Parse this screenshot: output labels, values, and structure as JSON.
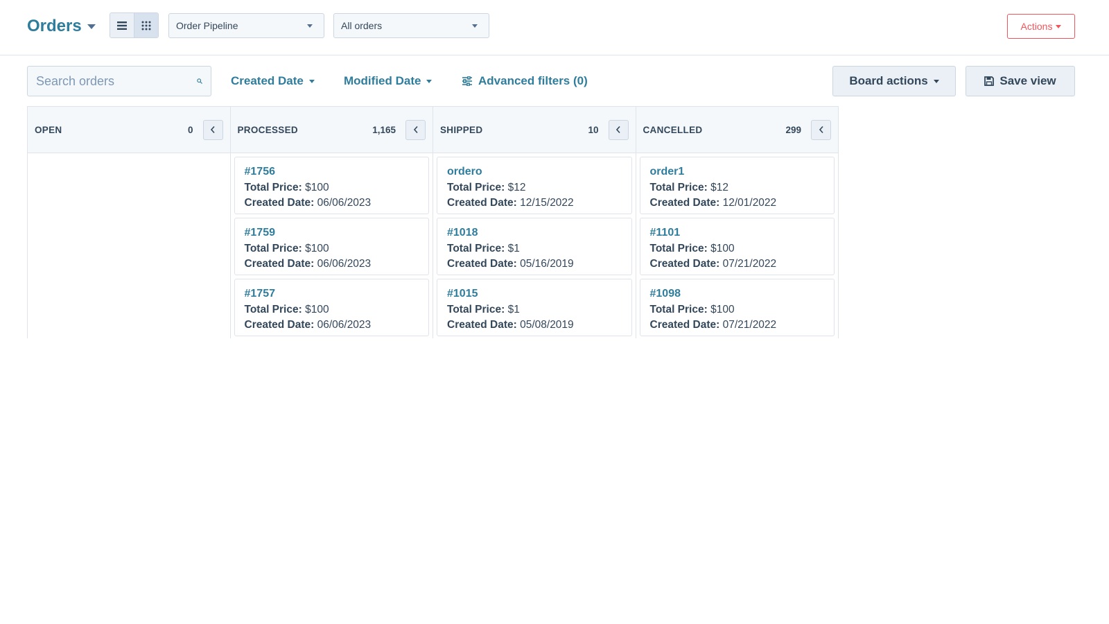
{
  "header": {
    "title": "Orders",
    "pipeline_select": "Order Pipeline",
    "view_select": "All orders",
    "actions_label": "Actions"
  },
  "toolbar": {
    "search_placeholder": "Search orders",
    "created_date_filter": "Created Date",
    "modified_date_filter": "Modified Date",
    "advanced_filters": "Advanced filters (0)",
    "board_actions": "Board actions",
    "save_view": "Save view"
  },
  "card_labels": {
    "total_price": "Total Price:",
    "created_date": "Created Date:"
  },
  "columns": [
    {
      "name": "OPEN",
      "count": "0",
      "cards": []
    },
    {
      "name": "PROCESSED",
      "count": "1,165",
      "cards": [
        {
          "title": "#1756",
          "total_price": "$100",
          "created_date": "06/06/2023"
        },
        {
          "title": "#1759",
          "total_price": "$100",
          "created_date": "06/06/2023"
        },
        {
          "title": "#1757",
          "total_price": "$100",
          "created_date": "06/06/2023"
        }
      ]
    },
    {
      "name": "SHIPPED",
      "count": "10",
      "cards": [
        {
          "title": "ordero",
          "total_price": "$12",
          "created_date": "12/15/2022"
        },
        {
          "title": "#1018",
          "total_price": "$1",
          "created_date": "05/16/2019"
        },
        {
          "title": "#1015",
          "total_price": "$1",
          "created_date": "05/08/2019"
        }
      ]
    },
    {
      "name": "CANCELLED",
      "count": "299",
      "cards": [
        {
          "title": "order1",
          "total_price": "$12",
          "created_date": "12/01/2022"
        },
        {
          "title": "#1101",
          "total_price": "$100",
          "created_date": "07/21/2022"
        },
        {
          "title": "#1098",
          "total_price": "$100",
          "created_date": "07/21/2022"
        }
      ]
    }
  ],
  "colors": {
    "accent": "#2f7d9c",
    "text": "#33475b",
    "danger": "#f2545b",
    "panel": "#f5f8fa",
    "border": "#dfe3eb"
  },
  "icons": [
    "chevron-down-icon",
    "list-view-icon",
    "grid-view-icon",
    "search-icon",
    "sliders-icon",
    "save-icon",
    "chevron-left-icon"
  ]
}
